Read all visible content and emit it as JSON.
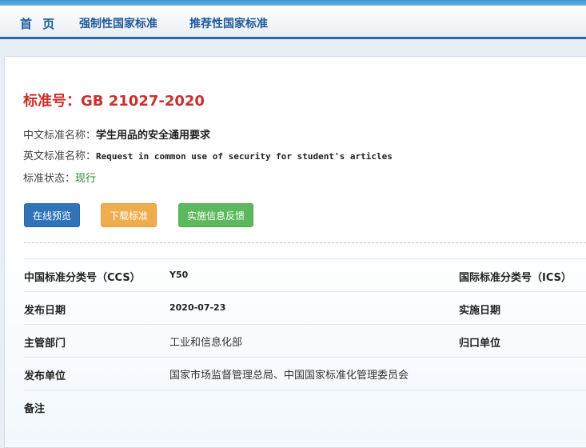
{
  "nav": {
    "home": "首 页",
    "mandatory": "强制性国家标准",
    "recommended": "推荐性国家标准"
  },
  "standard": {
    "title": "标准号：GB 21027-2020",
    "cn_name_label": "中文标准名称：",
    "cn_name": "学生用品的安全通用要求",
    "en_name_label": "英文标准名称：",
    "en_name": "Request in common use of security for student's articles",
    "status_label": "标准状态：",
    "status": "现行"
  },
  "buttons": {
    "preview": "在线预览",
    "download": "下载标准",
    "feedback": "实施信息反馈"
  },
  "details": {
    "ccs_label": "中国标准分类号（CCS）",
    "ccs_value": "Y50",
    "ics_label": "国际标准分类号（ICS）",
    "publish_date_label": "发布日期",
    "publish_date_value": "2020-07-23",
    "impl_date_label": "实施日期",
    "dept_label": "主管部门",
    "dept_value": "工业和信息化部",
    "centralized_label": "归口单位",
    "publisher_label": "发布单位",
    "publisher_value": "国家市场监督管理总局、中国国家标准化管理委员会",
    "remarks_label": "备注"
  },
  "colors": {
    "nav_accent": "#1f5a99",
    "title_red": "#c9302c",
    "status_green": "#2e7d32",
    "btn_blue": "#3073b8",
    "btn_orange": "#f0ad4e",
    "btn_green": "#5cb85c"
  }
}
